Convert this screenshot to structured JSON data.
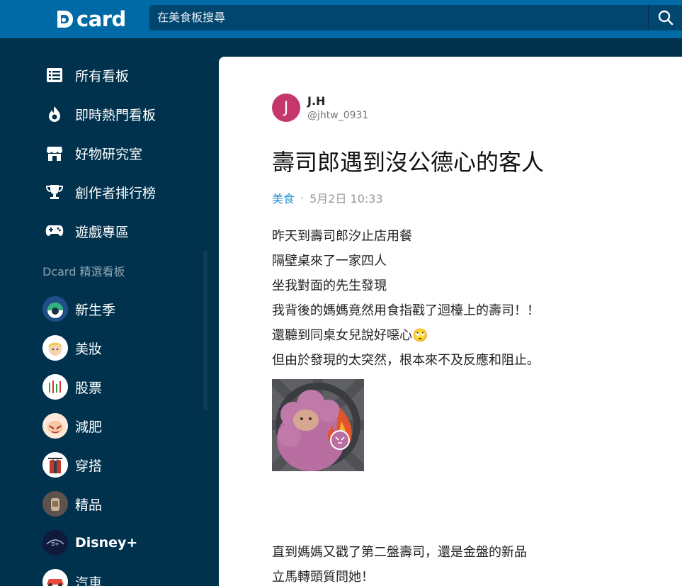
{
  "header": {
    "logo_text": "card",
    "search_placeholder": "在美食板搜尋"
  },
  "sidebar": {
    "nav_items": [
      {
        "label": "所有看板",
        "icon": "list-icon"
      },
      {
        "label": "即時熱門看板",
        "icon": "flame-icon"
      },
      {
        "label": "好物研究室",
        "icon": "store-icon"
      },
      {
        "label": "創作者排行榜",
        "icon": "trophy-icon"
      },
      {
        "label": "遊戲專區",
        "icon": "gamepad-icon"
      }
    ],
    "section_title": "Dcard 精選看板",
    "boards": [
      {
        "label": "新生季"
      },
      {
        "label": "美妝"
      },
      {
        "label": "股票"
      },
      {
        "label": "減肥"
      },
      {
        "label": "穿搭"
      },
      {
        "label": "精品"
      },
      {
        "label": "Disney+"
      },
      {
        "label": "汽車"
      }
    ]
  },
  "post": {
    "author_initial": "J",
    "author_name": "J.H",
    "author_handle": "@jhtw_0931",
    "title": "壽司郎遇到沒公德心的客人",
    "category": "美食",
    "separator": "·",
    "date": "5月2日 10:33",
    "lines": [
      "昨天到壽司郎汐止店用餐",
      "隔壁桌來了一家四人",
      "坐我對面的先生發現",
      "我背後的媽媽竟然用食指戳了迴檯上的壽司！！",
      "還聽到同桌女兒說好噁心🙄",
      "但由於發現的太突然，根本來不及反應和阻止。"
    ],
    "lines_after": [
      "直到媽媽又戳了第二盤壽司，還是金盤的新品",
      "立馬轉頭質問她！"
    ]
  },
  "colors": {
    "topbar": "#006aa6",
    "sidebar": "#00324e",
    "accent": "#3397cf",
    "avatar": "#c5376a"
  }
}
